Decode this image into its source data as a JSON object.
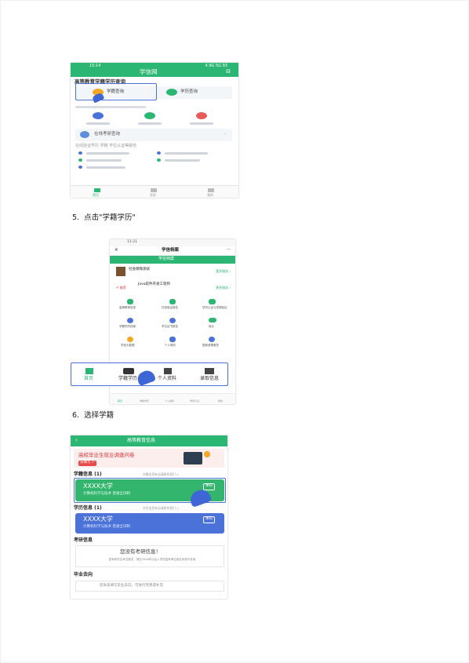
{
  "steps": {
    "step5": {
      "number": "5.",
      "text": "点击\"学籍学历\""
    },
    "step6": {
      "number": "6.",
      "text": "选择学籍"
    }
  },
  "screen1": {
    "status_time": "15:14",
    "status_right": "4.9G 5G 93 ",
    "app_title": "学信网",
    "section_title": "高等教育学籍学历查询",
    "btn_left": "学籍查询",
    "btn_right": "学历查询",
    "service_label": "在线考研查询",
    "list_title": "在线验证学历 学籍 学位认证等服务",
    "tabs": [
      "首页",
      "发现",
      "我的"
    ]
  },
  "screen2": {
    "status_time": "11:21",
    "nav_close": "✕",
    "nav_title": "学信档案",
    "nav_more": "···",
    "banner_text": "学信档案",
    "card1_title": "社会保障测试",
    "card1_link": "更多服务 ›",
    "card2_title": "Java软件开发工程师",
    "card2_link": "更多服务 ›",
    "card2_tag": "✔ 推荐",
    "grid": [
      {
        "label": "高等教育信息"
      },
      {
        "label": "在线验证报告"
      },
      {
        "label": "学历认证与成绩验证"
      },
      {
        "label": "学籍学历档案"
      },
      {
        "label": "学位证书报告"
      },
      {
        "label": "就业"
      },
      {
        "label": "学信大数据"
      },
      {
        "label": "个人简历"
      },
      {
        "label": "国家政策服务"
      }
    ],
    "bottom_tabs": [
      "首页",
      "学籍学历",
      "个人资料",
      "录取信息"
    ],
    "mini_tabs": [
      "首页",
      "学籍学历",
      "个人资料",
      "学历认证",
      "我的"
    ]
  },
  "screen3": {
    "nav_back": "‹",
    "nav_title": "高等教育信息",
    "banner_title": "高校毕业生就业调查问卷",
    "banner_tag": "去填写 >",
    "xueji_title": "学籍信息 (1)",
    "xueji_hint": "学籍信息有误请联系我们 >",
    "xueji_card": {
      "name": "XXXX大学",
      "sub": "计算机科学与技术   普通全日制",
      "badge": "本科"
    },
    "xueli_title": "学历信息 (1)",
    "xueli_hint": "学历信息有误请联系我们 >",
    "xueli_card": {
      "name": "XXXX大学",
      "sub": "计算机科学与技术   普通全日制",
      "badge": "本科"
    },
    "kaoyan_title": "考研信息",
    "kaoyan_empty": "您没有考研信息！",
    "kaoyan_desc": "如有研究生考试报名，请在2006年以后入学的招考单位报名系统中查询",
    "biye_title": "毕业去向",
    "biye_text": "您尚未填写毕业去向，可进行完善或补充"
  },
  "colors": {
    "green": "#2bb673",
    "blue": "#4a72d9",
    "accent_orange": "#f5a623"
  }
}
